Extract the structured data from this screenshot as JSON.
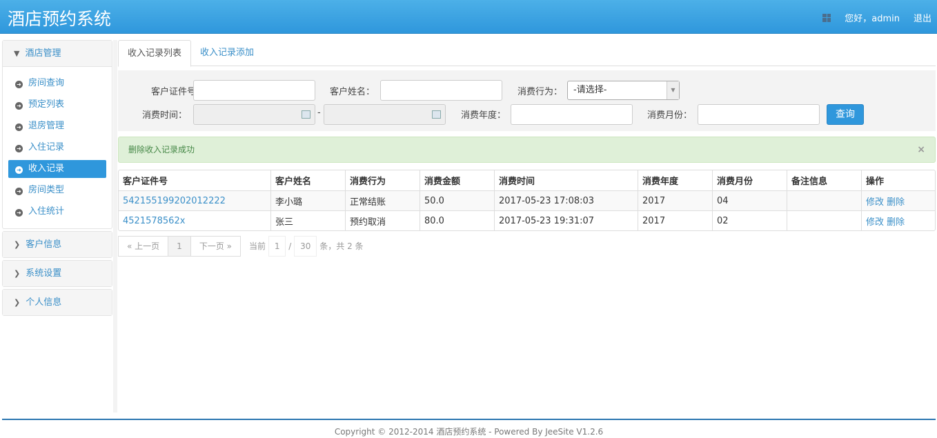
{
  "header": {
    "title": "酒店预约系统",
    "greeting": "您好，admin",
    "logout": "退出"
  },
  "sidebar": {
    "groups": [
      {
        "label": "酒店管理",
        "expanded": true,
        "items": [
          "房间查询",
          "预定列表",
          "退房管理",
          "入住记录",
          "收入记录",
          "房间类型",
          "入住统计"
        ],
        "active": 4
      },
      {
        "label": "客户信息"
      },
      {
        "label": "系统设置"
      },
      {
        "label": "个人信息"
      }
    ]
  },
  "tabs": [
    "收入记录列表",
    "收入记录添加"
  ],
  "search": {
    "id_label": "客户证件号：",
    "name_label": "客户姓名：",
    "action_label": "消费行为：",
    "action_value": "-请选择-",
    "time_label": "消费时间：",
    "dash": "-",
    "year_label": "消费年度：",
    "month_label": "消费月份：",
    "submit": "查询"
  },
  "alert": {
    "message": "删除收入记录成功",
    "close": "×"
  },
  "table": {
    "headers": [
      "客户证件号",
      "客户姓名",
      "消费行为",
      "消费金额",
      "消费时间",
      "消费年度",
      "消费月份",
      "备注信息",
      "操作"
    ],
    "rows": [
      [
        "542155199202012222",
        "李小璐",
        "正常结账",
        "50.0",
        "2017-05-23 17:08:03",
        "2017",
        "04",
        ""
      ],
      [
        "4521578562x",
        "张三",
        "预约取消",
        "80.0",
        "2017-05-23 19:31:07",
        "2017",
        "02",
        ""
      ]
    ],
    "edit": "修改",
    "delete": "删除"
  },
  "pager": {
    "prev": "« 上一页",
    "page": "1",
    "next": "下一页 »",
    "current": "当前",
    "cur_val": "1",
    "slash": "/",
    "size": "30",
    "suffix": "条，共 2 条"
  },
  "footer": "Copyright © 2012-2014 酒店预约系统 - Powered By JeeSite V1.2.6"
}
